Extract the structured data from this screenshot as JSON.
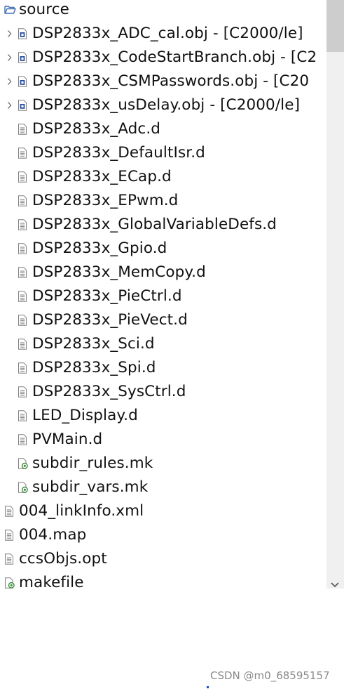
{
  "tree": {
    "root": {
      "label": "source"
    },
    "items": [
      {
        "label": "DSP2833x_ADC_cal.obj - [C2000/le]",
        "kind": "obj",
        "level": 1,
        "expandable": true
      },
      {
        "label": "DSP2833x_CodeStartBranch.obj - [C2",
        "kind": "obj",
        "level": 1,
        "expandable": true
      },
      {
        "label": "DSP2833x_CSMPasswords.obj - [C20",
        "kind": "obj",
        "level": 1,
        "expandable": true
      },
      {
        "label": "DSP2833x_usDelay.obj - [C2000/le]",
        "kind": "obj",
        "level": 1,
        "expandable": true
      },
      {
        "label": "DSP2833x_Adc.d",
        "kind": "file",
        "level": 1,
        "expandable": false
      },
      {
        "label": "DSP2833x_DefaultIsr.d",
        "kind": "file",
        "level": 1,
        "expandable": false
      },
      {
        "label": "DSP2833x_ECap.d",
        "kind": "file",
        "level": 1,
        "expandable": false
      },
      {
        "label": "DSP2833x_EPwm.d",
        "kind": "file",
        "level": 1,
        "expandable": false
      },
      {
        "label": "DSP2833x_GlobalVariableDefs.d",
        "kind": "file",
        "level": 1,
        "expandable": false
      },
      {
        "label": "DSP2833x_Gpio.d",
        "kind": "file",
        "level": 1,
        "expandable": false
      },
      {
        "label": "DSP2833x_MemCopy.d",
        "kind": "file",
        "level": 1,
        "expandable": false
      },
      {
        "label": "DSP2833x_PieCtrl.d",
        "kind": "file",
        "level": 1,
        "expandable": false
      },
      {
        "label": "DSP2833x_PieVect.d",
        "kind": "file",
        "level": 1,
        "expandable": false
      },
      {
        "label": "DSP2833x_Sci.d",
        "kind": "file",
        "level": 1,
        "expandable": false
      },
      {
        "label": "DSP2833x_Spi.d",
        "kind": "file",
        "level": 1,
        "expandable": false
      },
      {
        "label": "DSP2833x_SysCtrl.d",
        "kind": "file",
        "level": 1,
        "expandable": false
      },
      {
        "label": "LED_Display.d",
        "kind": "file",
        "level": 1,
        "expandable": false
      },
      {
        "label": "PVMain.d",
        "kind": "file",
        "level": 1,
        "expandable": false
      },
      {
        "label": "subdir_rules.mk",
        "kind": "makefile",
        "level": 1,
        "expandable": false
      },
      {
        "label": "subdir_vars.mk",
        "kind": "makefile",
        "level": 1,
        "expandable": false
      },
      {
        "label": "004_linkInfo.xml",
        "kind": "file",
        "level": 0,
        "expandable": false
      },
      {
        "label": "004.map",
        "kind": "file",
        "level": 0,
        "expandable": false
      },
      {
        "label": "ccsObjs.opt",
        "kind": "file",
        "level": 0,
        "expandable": false
      },
      {
        "label": "makefile",
        "kind": "makefile",
        "level": 0,
        "expandable": false
      }
    ]
  },
  "icons": {
    "folder": "folder-open-icon",
    "obj": "object-file-icon",
    "file": "text-file-icon",
    "makefile": "makefile-icon",
    "chevron": "chevron-right-icon"
  },
  "colors": {
    "folder_blue": "#3f6fb5",
    "file_gray": "#7a7a7a",
    "makefile_green": "#3e8e3e",
    "obj_blue": "#2b4fa8"
  },
  "watermark": "CSDN @m0_68595157"
}
